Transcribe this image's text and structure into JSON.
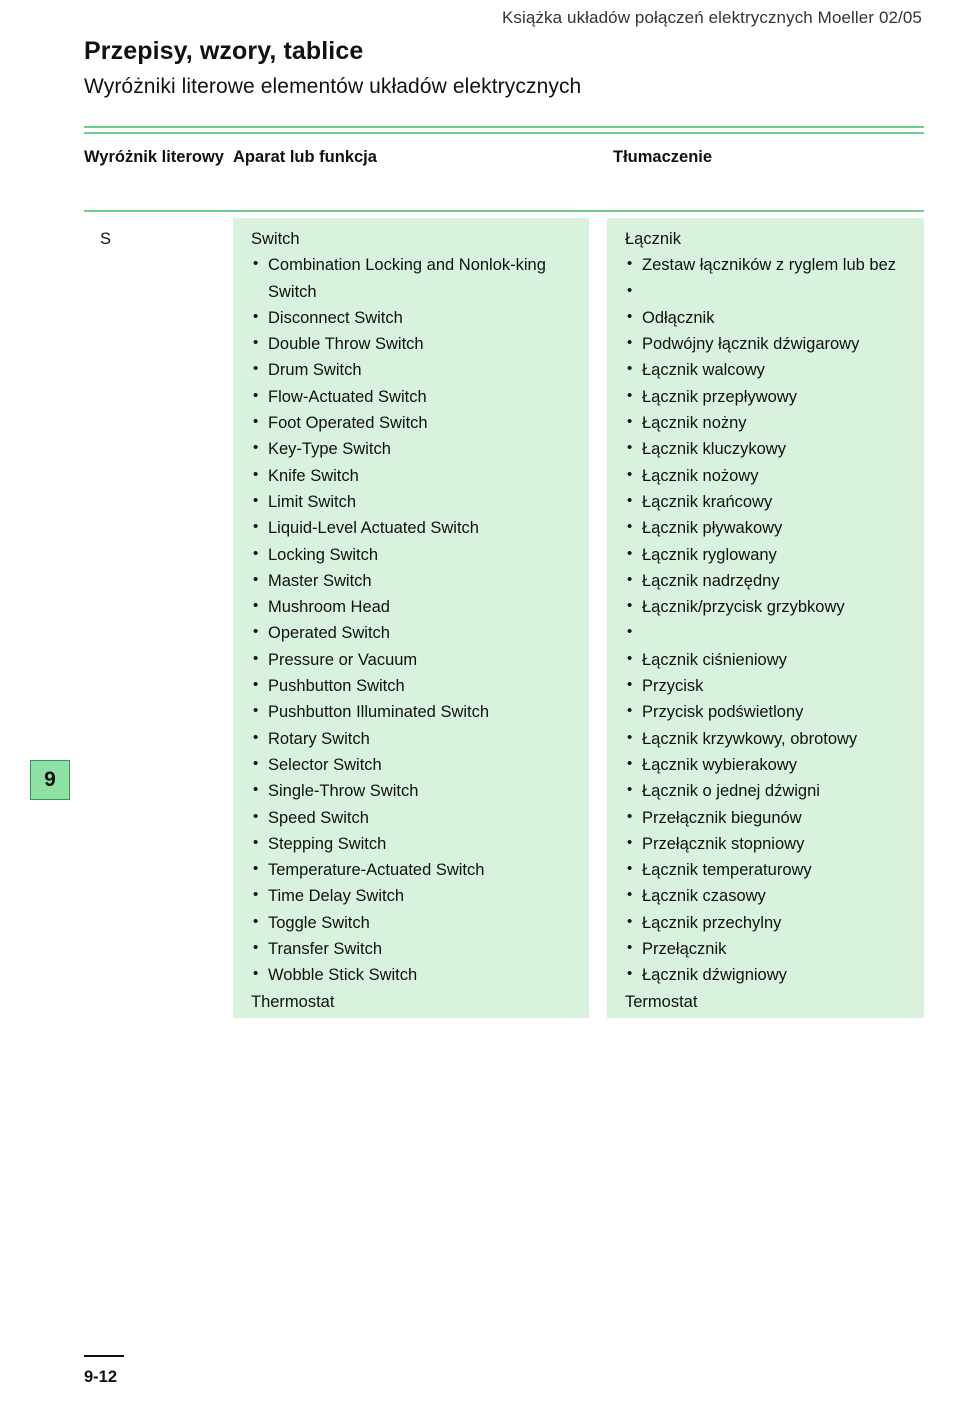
{
  "header": {
    "running_head": "Książka układów połączeń elektrycznych Moeller 02/05",
    "title": "Przepisy, wzory, tablice",
    "subtitle": "Wyróżniki literowe elementów układów elektrycznych"
  },
  "table": {
    "columns": [
      {
        "label": "Wyróżnik literowy"
      },
      {
        "label": "Aparat lub funkcja"
      },
      {
        "label": "Tłumaczenie"
      }
    ],
    "letter": "S",
    "device_column": {
      "lead": "Switch",
      "items": [
        "Combination Locking and Nonlok-king Switch",
        "Disconnect Switch",
        "Double Throw Switch",
        "Drum Switch",
        "Flow-Actuated Switch",
        "Foot Operated Switch",
        "Key-Type Switch",
        "Knife Switch",
        "Limit Switch",
        "Liquid-Level Actuated Switch",
        "Locking Switch",
        "Master Switch",
        "Mushroom Head",
        "Operated Switch",
        "Pressure or Vacuum",
        "Pushbutton Switch",
        "Pushbutton Illuminated Switch",
        "Rotary Switch",
        "Selector Switch",
        "Single-Throw Switch",
        "Speed Switch",
        "Stepping Switch",
        "Temperature-Actuated Switch",
        "Time Delay Switch",
        "Toggle Switch",
        "Transfer Switch",
        "Wobble Stick Switch"
      ],
      "tail": "Thermostat"
    },
    "translation_column": {
      "lead": "Łącznik",
      "items": [
        "Zestaw łączników z ryglem lub bez",
        "Odłącznik",
        "Podwójny łącznik dźwigarowy",
        "Łącznik walcowy",
        "Łącznik przepływowy",
        "Łącznik nożny",
        "Łącznik kluczykowy",
        "Łącznik nożowy",
        "Łącznik krańcowy",
        "Łącznik pływakowy",
        "Łącznik ryglowany",
        "Łącznik nadrzędny",
        "Łącznik/przycisk grzybkowy",
        "Łącznik ciśnieniowy",
        "Przycisk",
        "Przycisk podświetlony",
        "Łącznik krzywkowy, obrotowy",
        "Łącznik wybierakowy",
        "Łącznik o jednej dźwigni",
        "Przełącznik biegunów",
        "Przełącznik stopniowy",
        "Łącznik temperaturowy",
        "Łącznik czasowy",
        "Łącznik przechylny",
        "Przełącznik",
        "Łącznik dźwigniowy"
      ],
      "tail": "Termostat"
    }
  },
  "chapter_tab": {
    "number": "9"
  },
  "footer": {
    "page_number": "9-12"
  },
  "colors": {
    "panel_green": "#d9f2de",
    "rule_green": "#6fce8f",
    "tab_green": "#8ee0a5",
    "tab_border": "#2f9c52"
  }
}
